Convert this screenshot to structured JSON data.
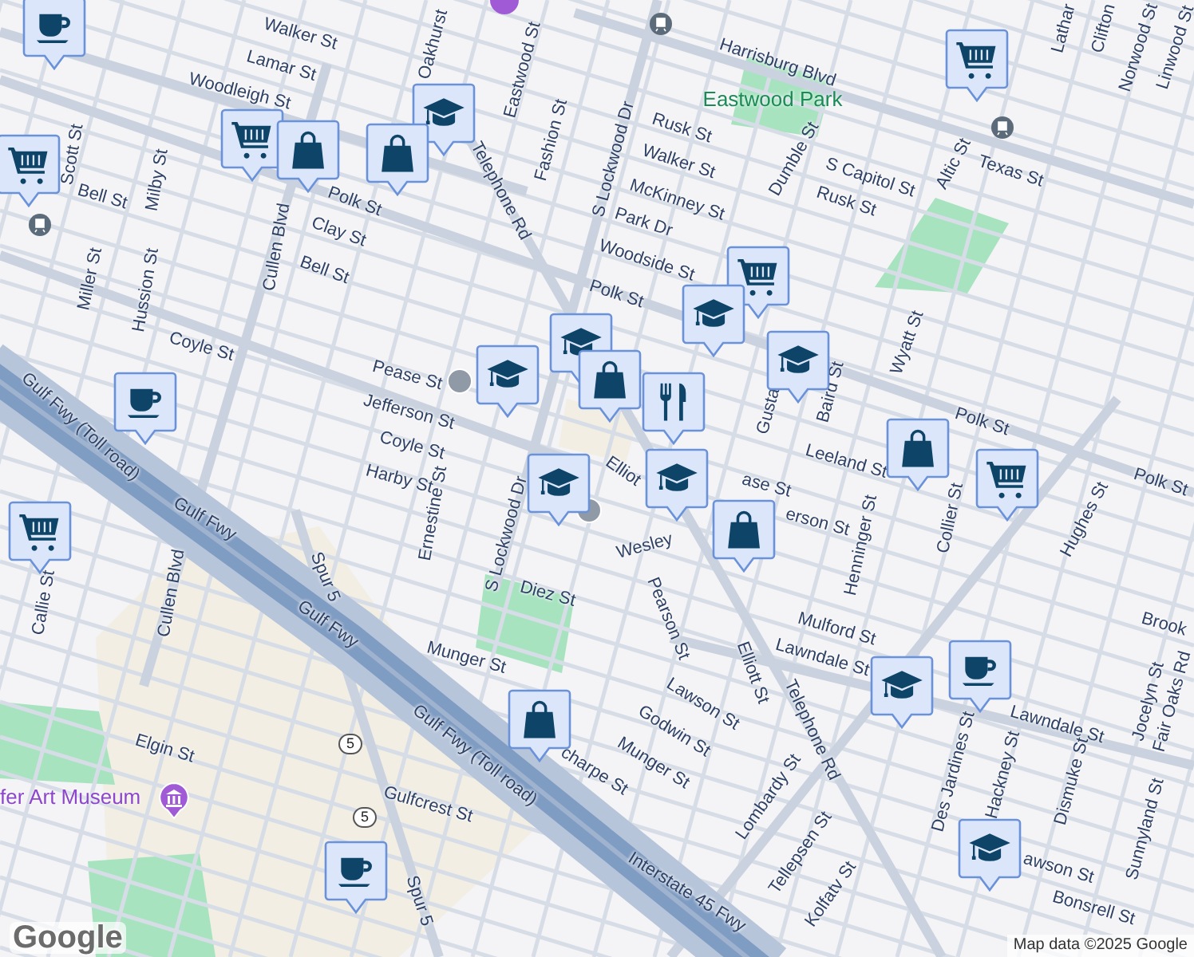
{
  "map": {
    "street_labels": [
      {
        "text": "Walker St"
      },
      {
        "text": "Lamar St"
      },
      {
        "text": "Woodleigh St"
      },
      {
        "text": "Oakhurst"
      },
      {
        "text": "Eastwood St"
      },
      {
        "text": "Fashion St"
      },
      {
        "text": "Scott St"
      },
      {
        "text": "Bell St"
      },
      {
        "text": "Milby St"
      },
      {
        "text": "Polk St"
      },
      {
        "text": "Clay St"
      },
      {
        "text": "Bell St"
      },
      {
        "text": "Cullen Blvd"
      },
      {
        "text": "Telephone Rd"
      },
      {
        "text": "Miller St"
      },
      {
        "text": "Hussion St"
      },
      {
        "text": "Coyle St"
      },
      {
        "text": "S Lockwood Dr"
      },
      {
        "text": "Harrisburg Blvd"
      },
      {
        "text": "Rusk St"
      },
      {
        "text": "Walker St"
      },
      {
        "text": "McKinney St"
      },
      {
        "text": "Park Dr"
      },
      {
        "text": "Woodside St"
      },
      {
        "text": "Polk St"
      },
      {
        "text": "Dumble St"
      },
      {
        "text": "S Capitol St"
      },
      {
        "text": "Rusk St"
      },
      {
        "text": "Altic St"
      },
      {
        "text": "Texas St"
      },
      {
        "text": "Lathar"
      },
      {
        "text": "Clifton"
      },
      {
        "text": "Norwood St"
      },
      {
        "text": "Linwood St"
      },
      {
        "text": "Pease St"
      },
      {
        "text": "Jefferson St"
      },
      {
        "text": "Coyle St"
      },
      {
        "text": "Harby St"
      },
      {
        "text": "Ernestine St"
      },
      {
        "text": "S Lockwood Dr"
      },
      {
        "text": "Diez St"
      },
      {
        "text": "Gulf Fwy (Toll road)"
      },
      {
        "text": "Gulf Fwy"
      },
      {
        "text": "Gulf Fwy"
      },
      {
        "text": "Spur 5"
      },
      {
        "text": "Cullen Blvd"
      },
      {
        "text": "Callie St"
      },
      {
        "text": "Munger St"
      },
      {
        "text": "Elgin St"
      },
      {
        "text": "Gulf Fwy (Toll road)"
      },
      {
        "text": "Gulfcrest St"
      },
      {
        "text": "Spur 5"
      },
      {
        "text": "Interstate 45 Fwy"
      },
      {
        "text": "Elliot"
      },
      {
        "text": "ase St"
      },
      {
        "text": "erson St"
      },
      {
        "text": "Wesley"
      },
      {
        "text": "Gusta"
      },
      {
        "text": "Baird St"
      },
      {
        "text": "Wyatt St"
      },
      {
        "text": "Polk St"
      },
      {
        "text": "Leeland St"
      },
      {
        "text": "Henninger St"
      },
      {
        "text": "Collier St"
      },
      {
        "text": "Hughes St"
      },
      {
        "text": "Polk St"
      },
      {
        "text": "Mulford St"
      },
      {
        "text": "Brook"
      },
      {
        "text": "Pearson St"
      },
      {
        "text": "Elliott St"
      },
      {
        "text": "Lawndale St"
      },
      {
        "text": "Lawson St"
      },
      {
        "text": "Godwin St"
      },
      {
        "text": "Munger St"
      },
      {
        "text": "charpe St"
      },
      {
        "text": "Telephone Rd"
      },
      {
        "text": "Lombardy St"
      },
      {
        "text": "Tellepsen St"
      },
      {
        "text": "Kolfatv St"
      },
      {
        "text": "Lawndale St"
      },
      {
        "text": "Des Jardines St"
      },
      {
        "text": "Hackney St"
      },
      {
        "text": "Dismuke St"
      },
      {
        "text": "Jocelyn St"
      },
      {
        "text": "Fair Oaks Rd"
      },
      {
        "text": "Sunnyland St"
      },
      {
        "text": "awson St"
      },
      {
        "text": "Bonsrell St"
      }
    ],
    "park_labels": [
      {
        "text": "Eastwood Park"
      }
    ],
    "poi_labels": [
      {
        "text": "fer Art Museum"
      }
    ],
    "route_shields": [
      {
        "text": "5"
      },
      {
        "text": "5"
      }
    ],
    "pins": [
      {
        "kind": "cafe"
      },
      {
        "kind": "school"
      },
      {
        "kind": "grocery"
      },
      {
        "kind": "grocery"
      },
      {
        "kind": "shopping"
      },
      {
        "kind": "shopping"
      },
      {
        "kind": "grocery"
      },
      {
        "kind": "grocery"
      },
      {
        "kind": "school"
      },
      {
        "kind": "school"
      },
      {
        "kind": "school"
      },
      {
        "kind": "school"
      },
      {
        "kind": "shopping"
      },
      {
        "kind": "restaurant"
      },
      {
        "kind": "school"
      },
      {
        "kind": "cafe"
      },
      {
        "kind": "shopping"
      },
      {
        "kind": "grocery"
      },
      {
        "kind": "grocery"
      },
      {
        "kind": "school"
      },
      {
        "kind": "shopping"
      },
      {
        "kind": "shopping"
      },
      {
        "kind": "cafe"
      },
      {
        "kind": "school"
      },
      {
        "kind": "cafe"
      },
      {
        "kind": "school"
      }
    ],
    "logo": "Google",
    "attribution": "Map data ©2025 Google"
  }
}
